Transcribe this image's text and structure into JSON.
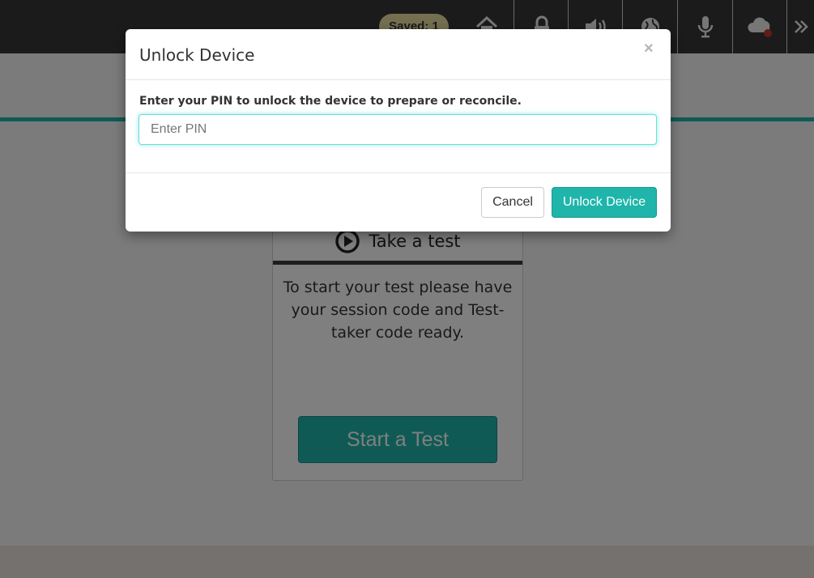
{
  "toolbar": {
    "saved_badge": "Saved: 1",
    "icons": [
      "home-icon",
      "lock-icon",
      "volume-icon",
      "globe-icon",
      "microphone-icon",
      "cloud-icon",
      "double-chevron-right-icon"
    ]
  },
  "card": {
    "title": "Take a test",
    "description": "To start your test please have your session code and Test-taker code ready.",
    "start_button": "Start a Test"
  },
  "modal": {
    "title": "Unlock Device",
    "close_symbol": "×",
    "label": "Enter your PIN to unlock the device to prepare or reconcile.",
    "pin_placeholder": "Enter PIN",
    "pin_value": "",
    "cancel_label": "Cancel",
    "unlock_label": "Unlock Device"
  },
  "colors": {
    "accent": "#1fb5aa",
    "topbar": "#363636",
    "saved_badge": "#e9dfa0",
    "cloud_status_dot": "#c0392b"
  }
}
